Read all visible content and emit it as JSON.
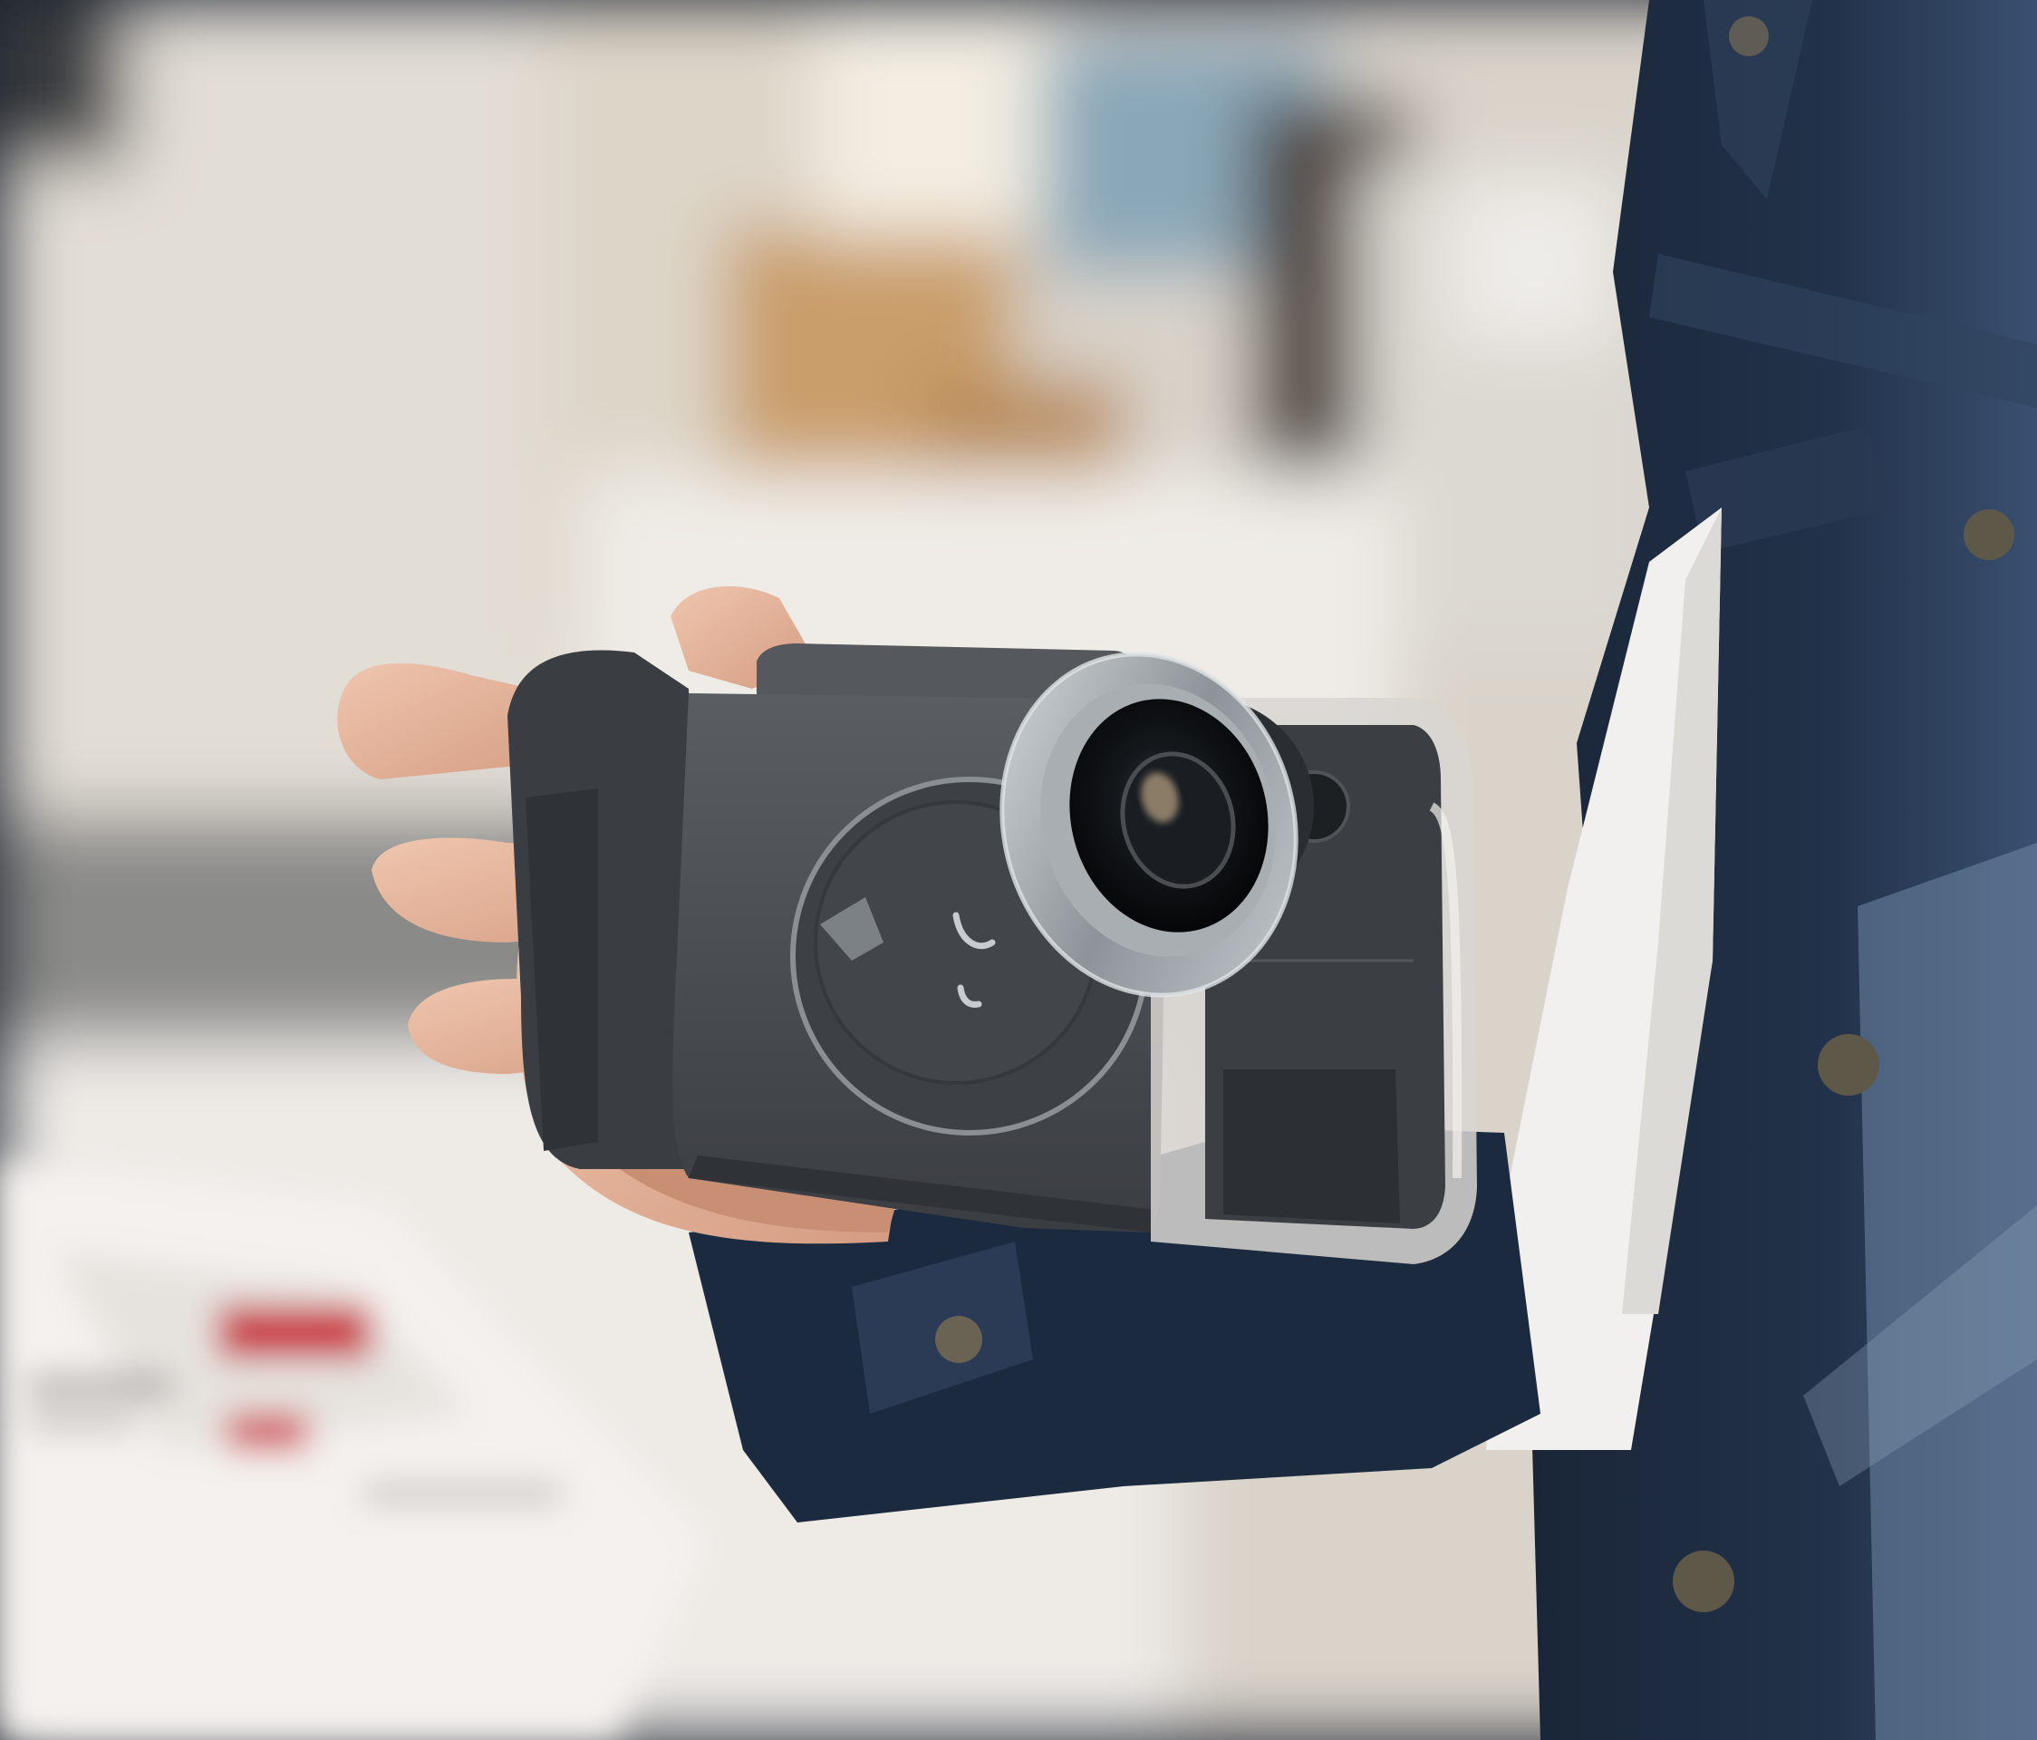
{
  "scene": {
    "palette": {
      "wall_light": "#e9e4dc",
      "wall_warm": "#cfae82",
      "shelf_wood": "#b8895a",
      "table_white": "#efece8",
      "paper": "#f4f1ee",
      "paper_red": "#c9343f",
      "denim_dark": "#18253a",
      "denim_mid": "#2d3e58",
      "denim_light": "#6f89a6",
      "shirt_white": "#f2f0ee",
      "skin": "#e5b8a0",
      "skin_shadow": "#b98066",
      "case_grey": "#4a4e52",
      "case_dark": "#2f3236",
      "case_edge": "#8a8f94",
      "lens_metal": "#b9bec4",
      "lens_glass": "#101418",
      "lens_glint": "#e8c9a2",
      "clear_case": "#d8d6d2",
      "button_brass": "#5e5848"
    },
    "icons": [
      "camera-grip-case",
      "clip-on-lens"
    ]
  }
}
